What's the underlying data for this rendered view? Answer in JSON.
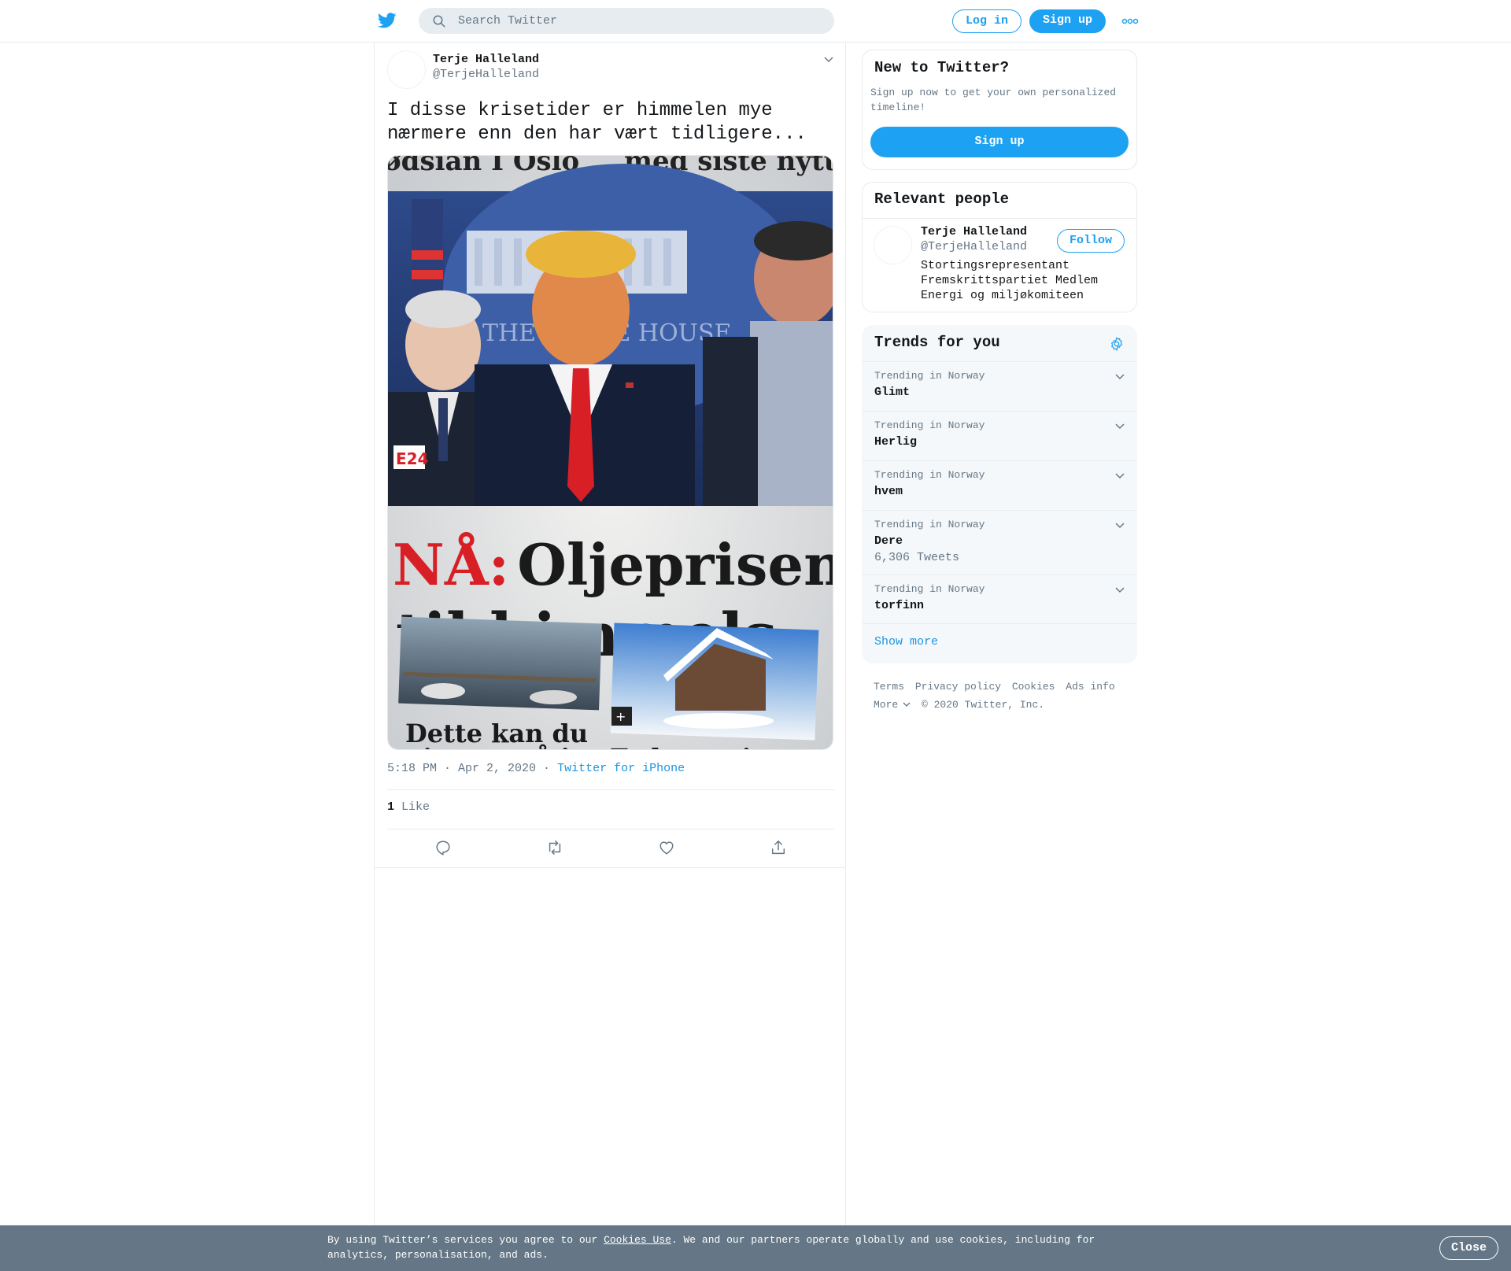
{
  "header": {
    "search_placeholder": "Search Twitter",
    "login_label": "Log in",
    "signup_label": "Sign up"
  },
  "tweet": {
    "author_name": "Terje Halleland",
    "author_handle": "@TerjeHalleland",
    "text": "I disse krisetider er himmelen mye nærmere enn den har vært tidligere...",
    "media": {
      "headline_top": "NÅ: Oljeprisen",
      "headline_bottom": "til himmels",
      "masthead_fragment_left": "ødsian I Oslo",
      "masthead_fragment_right": "med siste nytt",
      "caption_left": "Dette kan du",
      "caption_left_2": "gjøre også i",
      "caption_right": "Er hytteui",
      "logo": "E24",
      "wall_text": "THE WHITE HOUSE"
    },
    "time": "5:18 PM · Apr 2, 2020",
    "separator": "·",
    "source": "Twitter for iPhone",
    "like_count": "1",
    "like_label": "Like"
  },
  "sidebar": {
    "new_to_twitter": {
      "title": "New to Twitter?",
      "description": "Sign up now to get your own personalized timeline!",
      "button": "Sign up"
    },
    "relevant_people": {
      "title": "Relevant people",
      "name": "Terje Halleland",
      "handle": "@TerjeHalleland",
      "follow": "Follow",
      "bio": "Stortingsrepresentant Fremskrittspartiet Medlem Energi og miljøkomiteen"
    },
    "trends": {
      "title": "Trends for you",
      "items": [
        {
          "label": "Trending in Norway",
          "name": "Glimt",
          "count": ""
        },
        {
          "label": "Trending in Norway",
          "name": "Herlig",
          "count": ""
        },
        {
          "label": "Trending in Norway",
          "name": "hvem",
          "count": ""
        },
        {
          "label": "Trending in Norway",
          "name": "Dere",
          "count": "6,306 Tweets"
        },
        {
          "label": "Trending in Norway",
          "name": "torfinn",
          "count": ""
        }
      ],
      "show_more": "Show more"
    },
    "footer": {
      "terms": "Terms",
      "privacy": "Privacy policy",
      "cookies": "Cookies",
      "ads": "Ads info",
      "more": "More",
      "copyright": "© 2020 Twitter, Inc."
    }
  },
  "cookie_banner": {
    "text_before": "By using Twitter’s services you agree to our ",
    "link": "Cookies Use",
    "text_after": ". We and our partners operate globally and use cookies, including for analytics, personalisation, and ads.",
    "close": "Close"
  },
  "colors": {
    "accent": "#1da1f2",
    "link": "#1b95e0",
    "muted": "#657786",
    "banner": "#657786"
  }
}
